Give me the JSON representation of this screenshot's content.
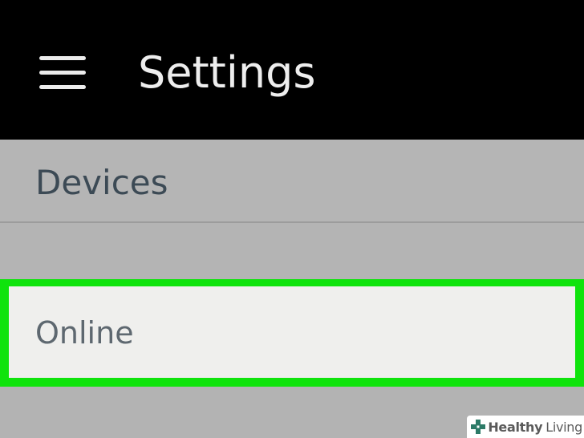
{
  "header": {
    "menu_icon": "hamburger-menu-icon",
    "title": "Settings"
  },
  "settings_list": {
    "devices_label": "Devices",
    "online_label": "Online"
  },
  "highlight": {
    "color": "#0fe30c"
  },
  "watermark": {
    "icon": "plus-cross-icon",
    "text_bold": "Healthy",
    "text_regular": "Living"
  }
}
